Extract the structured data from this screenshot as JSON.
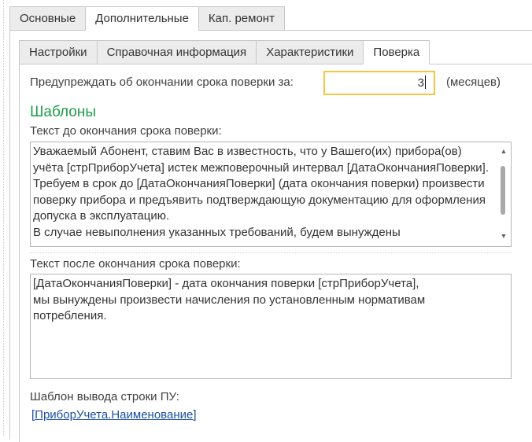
{
  "outer_tabs": [
    {
      "label": "Основные",
      "active": false
    },
    {
      "label": "Дополнительные",
      "active": true
    },
    {
      "label": "Кап. ремонт",
      "active": false
    }
  ],
  "inner_tabs": [
    {
      "label": "Настройки",
      "active": false
    },
    {
      "label": "Справочная информация",
      "active": false
    },
    {
      "label": "Характеристики",
      "active": false
    },
    {
      "label": "Поверка",
      "active": true
    }
  ],
  "warning": {
    "label": "Предупреждать об окончании срока поверки за:",
    "value": "3",
    "unit": "(месяцев)"
  },
  "templates": {
    "title": "Шаблоны",
    "before_label": "Текст до окончания срока поверки:",
    "before_text": "Уважаемый Абонент, ставим Вас в известность, что у Вашего(их) прибора(ов) учёта [стрПриборУчета] истек межповерочный интервал [ДатаОкончанияПоверки].\nТребуем в срок до [ДатаОкончанияПоверки] (дата окончания поверки) произвести поверку прибора и предъявить подтверждающую документацию для оформления допуска в эксплуатацию.\nВ случае невыполнения указанных требований, будем вынуждены",
    "after_label": "Текст после окончания срока поверки:",
    "after_text": "[ДатаОкончанияПоверки] - дата окончания поверки [стрПриборУчета],\nмы вынуждены произвести начисления по установленным нормативам потребления.",
    "row_label": "Шаблон вывода строки ПУ:",
    "row_link": "[ПриборУчета.Наименование]"
  }
}
